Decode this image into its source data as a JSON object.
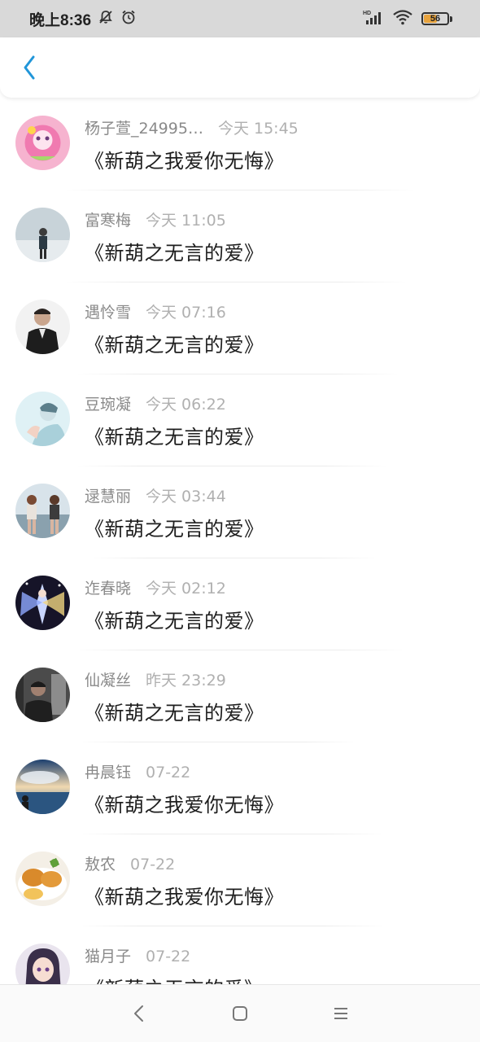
{
  "status_bar": {
    "time": "晚上8:36",
    "battery": "56",
    "battery_level": 0.56,
    "icons": [
      "bell-off-icon",
      "alarm-icon",
      "hd-signal-icon",
      "wifi-icon",
      "battery-icon"
    ]
  },
  "header": {
    "back_icon": "chevron-left-icon"
  },
  "messages": [
    {
      "sender": "杨子萱_24995…",
      "time": "今天 15:45",
      "title": "《新葫之我爱你无悔》",
      "avatar": "pink-cartoon-avatar"
    },
    {
      "sender": "富寒梅",
      "time": "今天 11:05",
      "title": "《新葫之无言的爱》",
      "avatar": "person-outdoor-avatar"
    },
    {
      "sender": "遇怜雪",
      "time": "今天 07:16",
      "title": "《新葫之无言的爱》",
      "avatar": "man-portrait-avatar"
    },
    {
      "sender": "豆琬凝",
      "time": "今天 06:22",
      "title": "《新葫之无言的爱》",
      "avatar": "light-portrait-avatar"
    },
    {
      "sender": "逯慧丽",
      "time": "今天 03:44",
      "title": "《新葫之无言的爱》",
      "avatar": "two-girls-avatar"
    },
    {
      "sender": "迮春晓",
      "time": "今天 02:12",
      "title": "《新葫之无言的爱》",
      "avatar": "anime-fantasy-avatar"
    },
    {
      "sender": "仙凝丝",
      "time": "昨天 23:29",
      "title": "《新葫之无言的爱》",
      "avatar": "dark-person-avatar"
    },
    {
      "sender": "冉晨钰",
      "time": "07-22",
      "title": "《新葫之我爱你无悔》",
      "avatar": "sky-sea-avatar"
    },
    {
      "sender": "敖农",
      "time": "07-22",
      "title": "《新葫之我爱你无悔》",
      "avatar": "fried-food-avatar"
    },
    {
      "sender": "猫月子",
      "time": "07-22",
      "title": "《新葫之无言的爱》",
      "avatar": "anime-girl-avatar"
    }
  ],
  "nav_bar": {
    "icons": [
      "back-triangle-icon",
      "home-square-icon",
      "menu-lines-icon"
    ]
  },
  "colors": {
    "accent": "#2196d9",
    "status_bg": "#d9d9d9",
    "battery": "#e8a33d"
  }
}
